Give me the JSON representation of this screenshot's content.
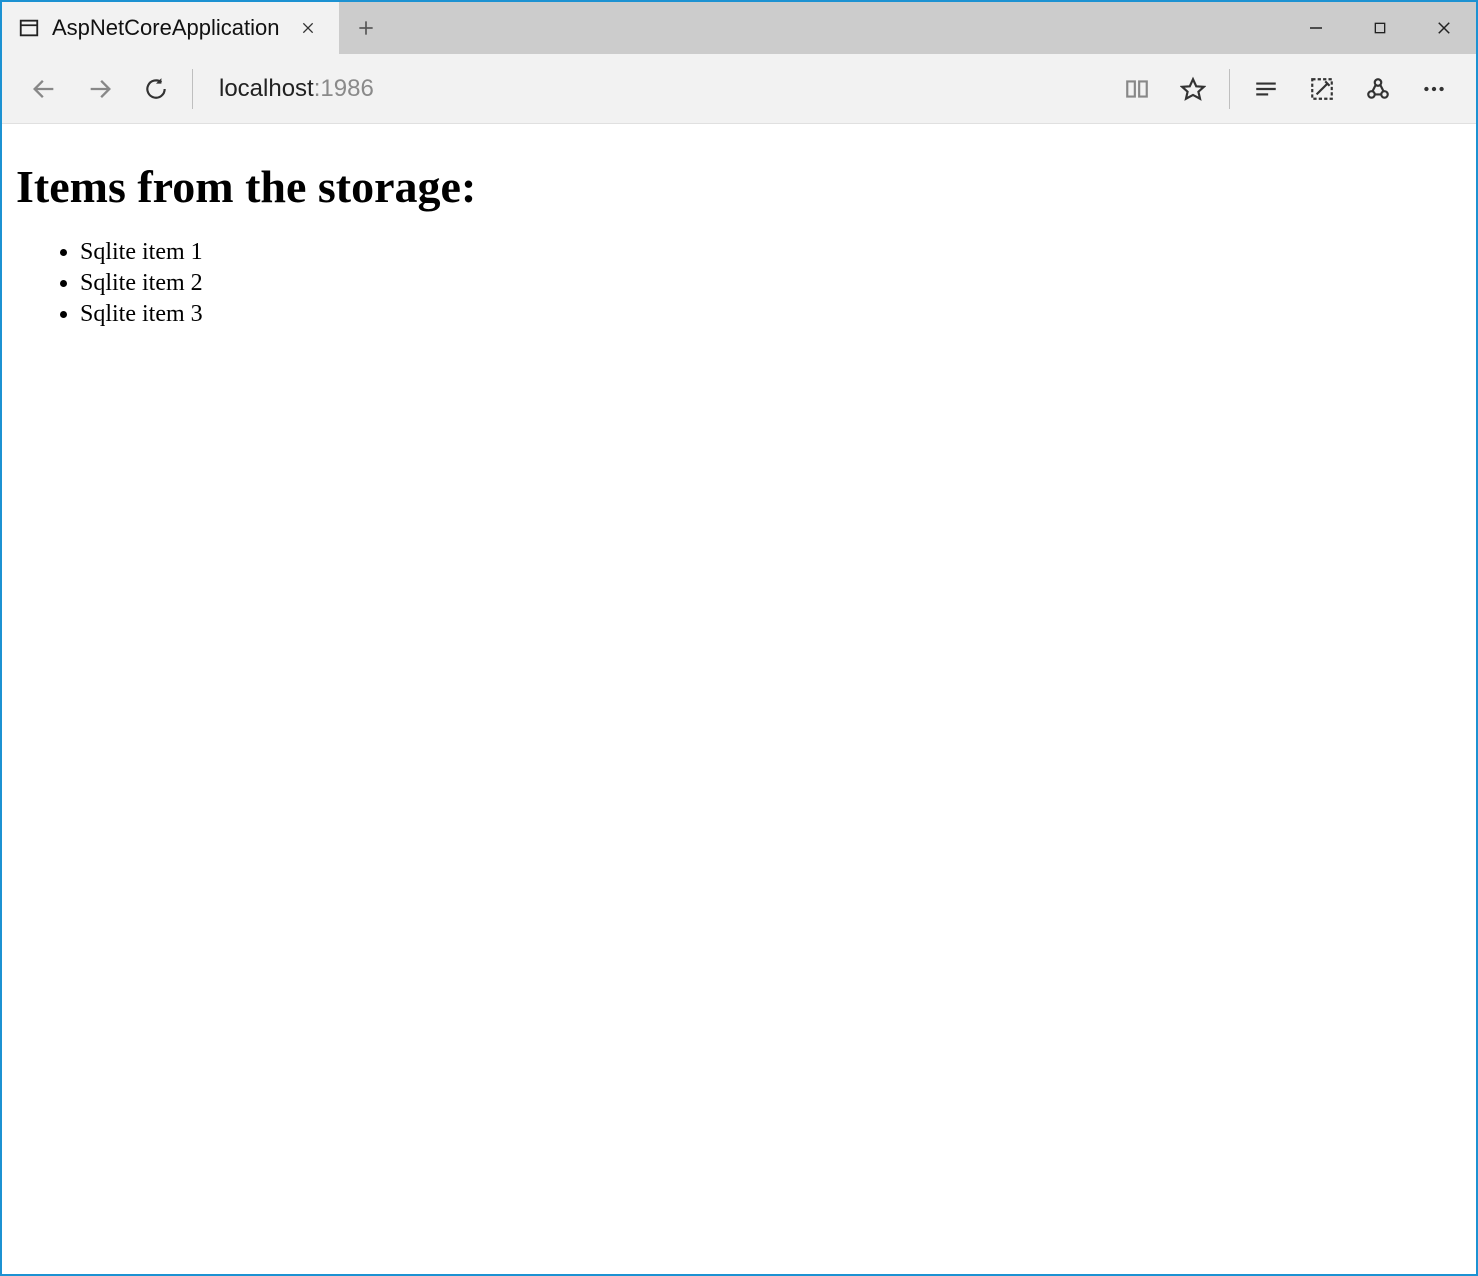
{
  "tab": {
    "title": "AspNetCoreApplication"
  },
  "address": {
    "host": "localhost",
    "port": ":1986"
  },
  "page": {
    "heading": "Items from the storage:",
    "items": [
      "Sqlite item 1",
      "Sqlite item 2",
      "Sqlite item 3"
    ]
  }
}
